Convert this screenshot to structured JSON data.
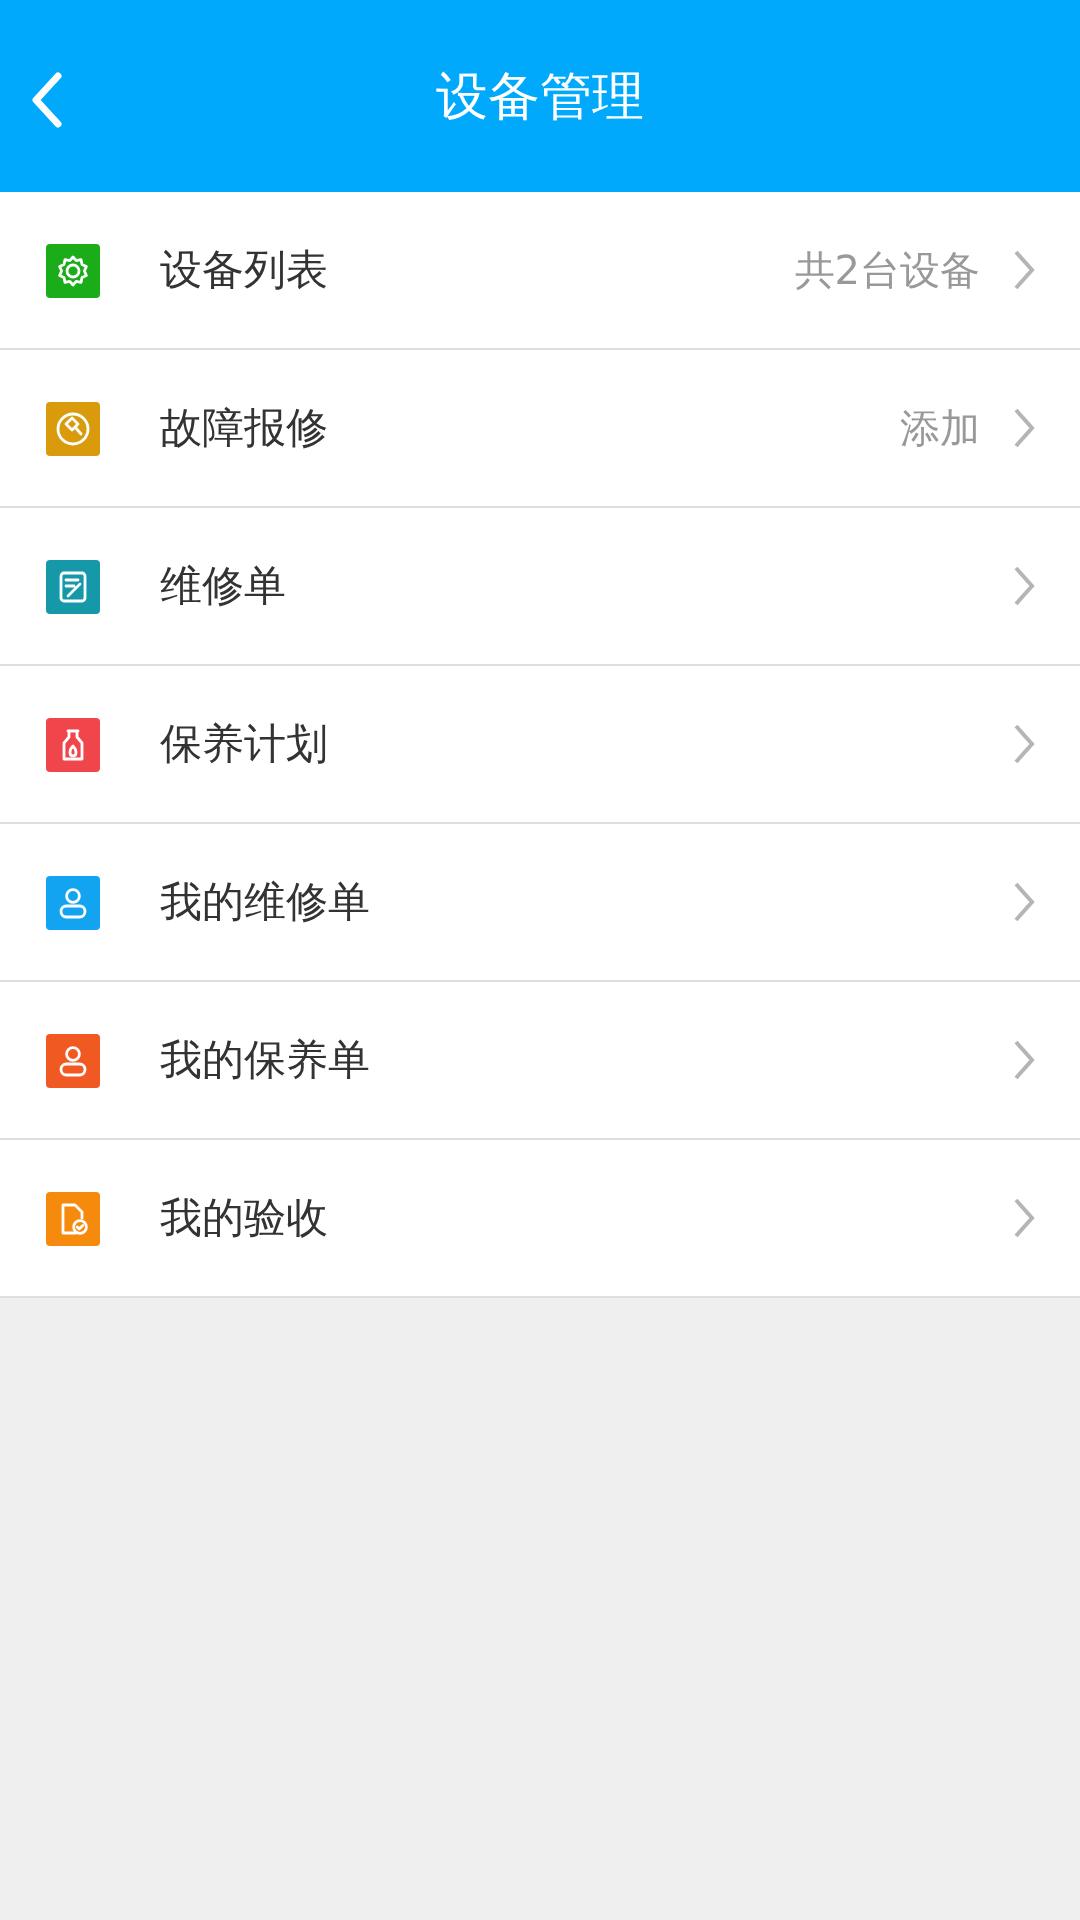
{
  "header": {
    "title": "设备管理"
  },
  "items": [
    {
      "label": "设备列表",
      "value": "共2台设备",
      "kind": "gear",
      "color": "#1aad19"
    },
    {
      "label": "故障报修",
      "value": "添加",
      "kind": "hammer",
      "color": "#d99a0b"
    },
    {
      "label": "维修单",
      "kind": "note",
      "color": "#1599a8"
    },
    {
      "label": "保养计划",
      "kind": "bottle",
      "color": "#f0464b"
    },
    {
      "label": "我的维修单",
      "kind": "person",
      "color": "#12a4f0"
    },
    {
      "label": "我的保养单",
      "kind": "person",
      "color": "#f05a22"
    },
    {
      "label": "我的验收",
      "kind": "doc-check",
      "color": "#f58a0c"
    }
  ]
}
